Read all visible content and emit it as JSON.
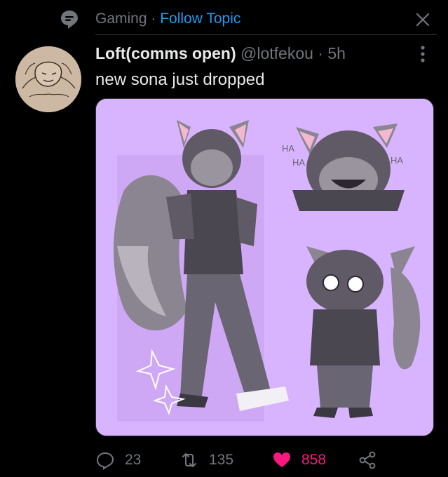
{
  "topic": {
    "label": "Gaming",
    "separator": "·",
    "follow_label": "Follow Topic"
  },
  "tweet": {
    "display_name": "Loft(comms open)",
    "handle": "@lotfekou",
    "dot": "·",
    "time": "5h",
    "text": "new sona just dropped",
    "media_alt": "character reference art of a gray wolf sona on a purple background",
    "art_text": {
      "ha1": "HA",
      "ha2": "HA",
      "ha3": "HA"
    }
  },
  "actions": {
    "replies": "23",
    "retweets": "135",
    "likes": "858"
  },
  "colors": {
    "background": "#000000",
    "accent": "#1d9bf0",
    "like": "#f91880",
    "muted": "#71767b",
    "media_bg": "#d8b4ff"
  }
}
